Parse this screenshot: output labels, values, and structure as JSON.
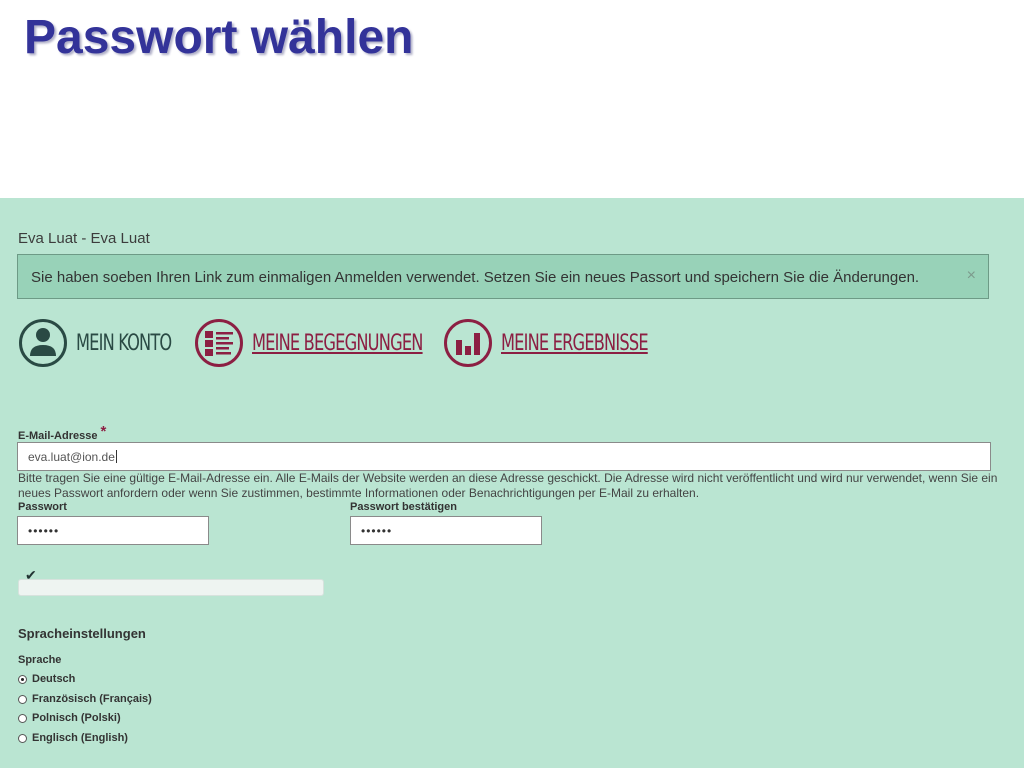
{
  "slide": {
    "title": "Passwort wählen"
  },
  "header": {
    "user_line": "Eva Luat - Eva Luat"
  },
  "alert": {
    "message": "Sie haben soeben Ihren Link zum einmaligen Anmelden verwendet. Setzen Sie ein neues Passort und speichern Sie die Änderungen.",
    "close": "×"
  },
  "nav": {
    "konto": {
      "label": "MEIN KONTO",
      "icon": "user-icon",
      "color": "#2a4a44"
    },
    "begegnungen": {
      "label": "MEINE BEGEGNUNGEN",
      "icon": "list-icon",
      "color": "#8c1f43"
    },
    "ergebnisse": {
      "label": "MEINE ERGEBNISSE",
      "icon": "bar-chart-icon",
      "color": "#8c1f43"
    }
  },
  "form": {
    "email": {
      "label": "E-Mail-Adresse",
      "required_mark": "*",
      "value": "eva.luat@ion.de",
      "description": "Bitte tragen Sie eine gültige E-Mail-Adresse ein. Alle E-Mails der Website werden an diese Adresse geschickt. Die Adresse wird nicht veröffentlicht und wird nur verwendet, wenn Sie ein neues Passwort anfordern oder wenn Sie zustimmen, bestimmte Informationen oder Benachrichtigungen per E-Mail zu erhalten."
    },
    "password": {
      "label": "Passwort",
      "value": "••••••"
    },
    "password_confirm": {
      "label": "Passwort bestätigen",
      "value": "••••••"
    },
    "strength_check": "✔"
  },
  "language": {
    "section_title": "Spracheinstellungen",
    "label": "Sprache",
    "options": [
      {
        "label": "Deutsch",
        "selected": true
      },
      {
        "label": "Französisch (Français)",
        "selected": false
      },
      {
        "label": "Polnisch (Polski)",
        "selected": false
      },
      {
        "label": "Englisch (English)",
        "selected": false
      }
    ]
  },
  "colors": {
    "title": "#333399",
    "panel_bg": "#bae5d2",
    "alert_bg": "#98d2b8",
    "accent": "#8c1f43",
    "dark_teal": "#2a4a44"
  }
}
